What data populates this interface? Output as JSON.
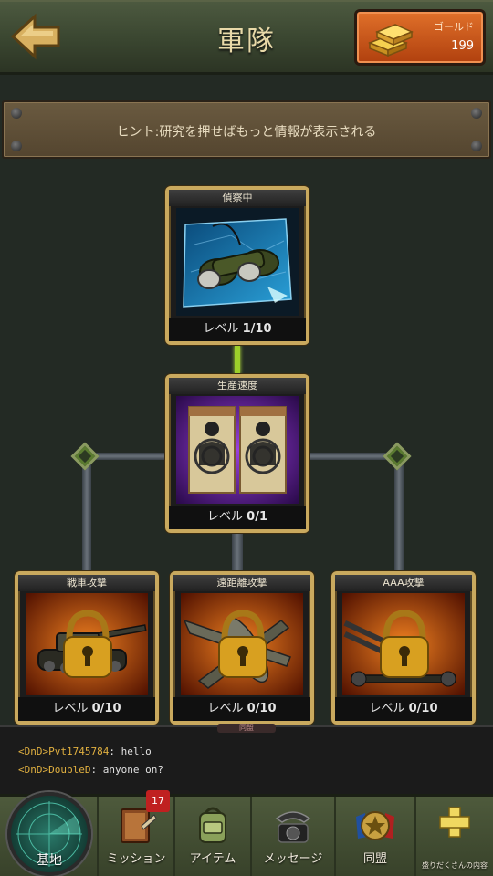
{
  "header": {
    "title": "軍隊",
    "currency_label": "ゴールド",
    "currency_value": "199"
  },
  "hint": "ヒント:研究を押せばもっと情報が表示される",
  "research": {
    "scouting": {
      "title": "偵察中",
      "level_label": "レベル",
      "level_value": "1/10",
      "icon": "binoculars-icon"
    },
    "production": {
      "title": "生産速度",
      "level_label": "レベル",
      "level_value": "0/1",
      "icon": "target-icon"
    },
    "tank_attack": {
      "title": "戦車攻撃",
      "level_label": "レベル",
      "level_value": "0/10",
      "icon": "tank-icon",
      "locked": true
    },
    "ranged_attack": {
      "title": "遠距離攻撃",
      "level_label": "レベル",
      "level_value": "0/10",
      "icon": "plane-icon",
      "locked": true
    },
    "aaa_attack": {
      "title": "AAA攻撃",
      "level_label": "レベル",
      "level_value": "0/10",
      "icon": "aa-gun-icon",
      "locked": true
    }
  },
  "chat": {
    "tab": "同盟",
    "messages": [
      {
        "prefix": "<DnD>",
        "name": "Pvt1745784",
        "text": ": hello"
      },
      {
        "prefix": "<DnD>",
        "name": "DoubleD",
        "text": ": anyone on?"
      }
    ]
  },
  "nav": {
    "base": "基地",
    "missions": "ミッション",
    "missions_badge": "17",
    "items": "アイテム",
    "messages": "メッセージ",
    "alliance": "同盟",
    "more": "盛りだくさんの内容"
  },
  "colors": {
    "card_border": "#c9a95e",
    "progress": "#f07a10",
    "active_link": "#9ccf2a",
    "gold_box": "#d05a1a"
  }
}
